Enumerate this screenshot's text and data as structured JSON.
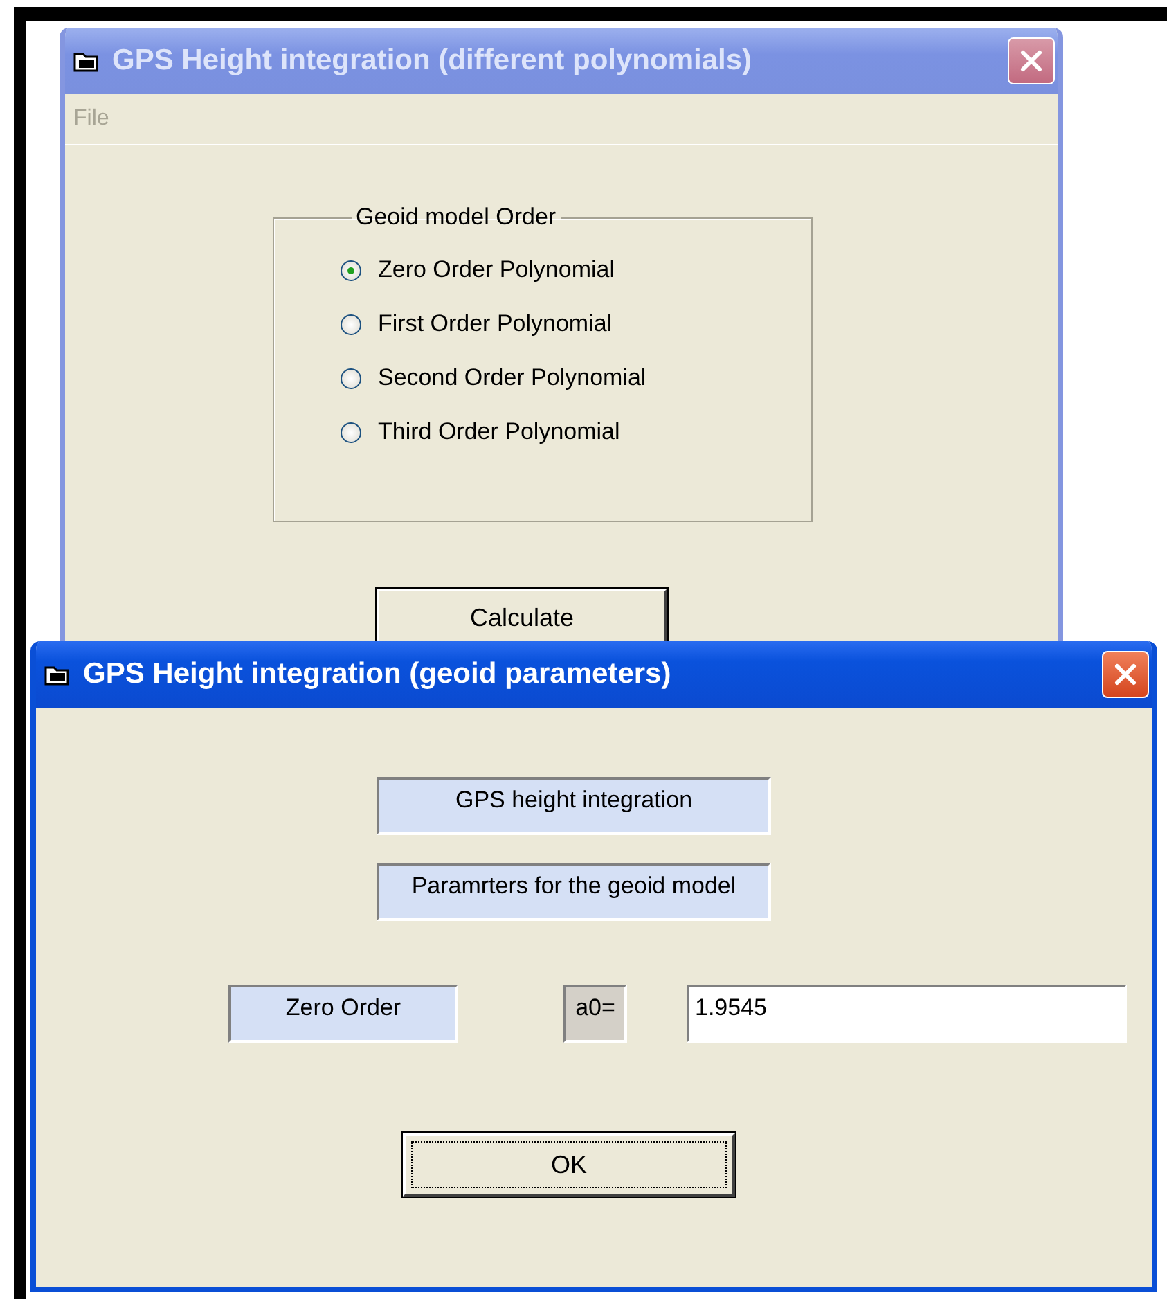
{
  "polynomial_window": {
    "title": "GPS Height integration (different polynomials)",
    "active": false,
    "menu": [
      "File"
    ],
    "group": {
      "title": "Geoid model Order",
      "options": [
        {
          "label": "Zero Order Polynomial",
          "selected": true
        },
        {
          "label": "First Order Polynomial",
          "selected": false
        },
        {
          "label": "Second Order Polynomial",
          "selected": false
        },
        {
          "label": "Third Order Polynomial",
          "selected": false
        }
      ]
    },
    "button": {
      "label": "Calculate",
      "focused": false
    }
  },
  "parameters_window": {
    "title": "GPS Height integration (geoid parameters)",
    "active": true,
    "heading": "GPS height integration",
    "subheading": "Paramrters for the geoid model",
    "order_label": "Zero Order",
    "coefficient_label": "a0=",
    "coefficient_value": "1.9545",
    "button": {
      "label": "OK",
      "focused": true
    }
  }
}
